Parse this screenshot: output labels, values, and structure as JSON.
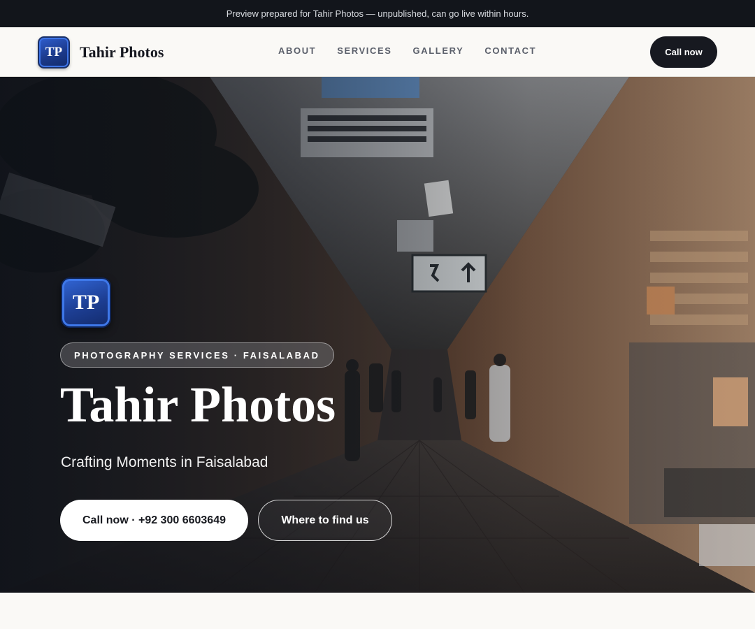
{
  "banner": {
    "text": "Preview prepared for Tahir Photos — unpublished, can go live within hours."
  },
  "nav": {
    "logo_text": "TP",
    "brand_name": "Tahir Photos",
    "links": [
      "ABOUT",
      "SERVICES",
      "GALLERY",
      "CONTACT"
    ],
    "cta": "Call now"
  },
  "hero": {
    "logo_text": "TP",
    "tagline": "PHOTOGRAPHY SERVICES · FAISALABAD",
    "title": "Tahir Photos",
    "subtitle": "Crafting Moments in Faisalabad",
    "primary_button": "Call now · +92 300 6603649",
    "secondary_button": "Where to find us"
  },
  "colors": {
    "dark": "#171920",
    "logo_blue": "#1d3e93",
    "page_bg": "#faf9f6"
  }
}
